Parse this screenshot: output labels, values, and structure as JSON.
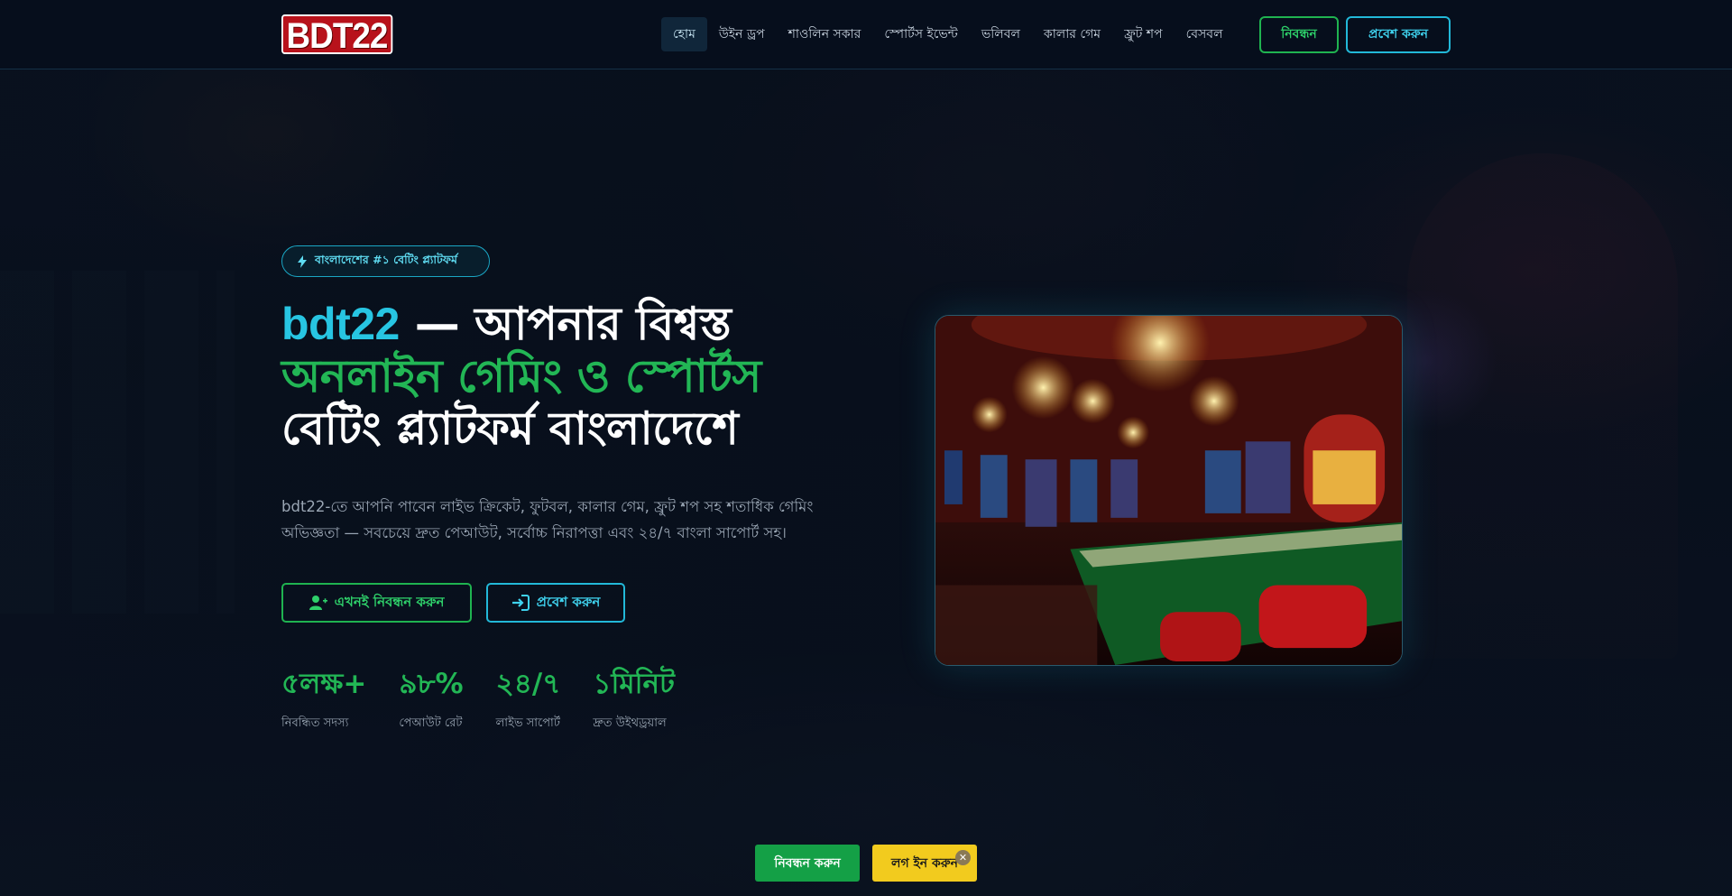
{
  "brand": {
    "logo_text": "BDT22"
  },
  "nav": {
    "items": [
      {
        "label": "হোম",
        "active": true
      },
      {
        "label": "উইন ড্রপ",
        "active": false
      },
      {
        "label": "শাওলিন সকার",
        "active": false
      },
      {
        "label": "স্পোর্টস ইভেন্ট",
        "active": false
      },
      {
        "label": "ভলিবল",
        "active": false
      },
      {
        "label": "কালার গেম",
        "active": false
      },
      {
        "label": "ফ্রুট শপ",
        "active": false
      },
      {
        "label": "বেসবল",
        "active": false
      }
    ],
    "register_label": "নিবন্ধন",
    "login_label": "প্রবেশ করুন"
  },
  "hero": {
    "badge": "বাংলাদেশের #১ বেটিং প্ল্যাটফর্ম",
    "title_brand": "bdt22",
    "title_part1": " — আপনার বিশ্বস্ত",
    "title_part2": "অনলাইন গেমিং ও স্পোর্টস",
    "title_part3": "বেটিং প্ল্যাটফর্ম বাংলাদেশে",
    "description": "bdt22-তে আপনি পাবেন লাইভ ক্রিকেট, ফুটবল, কালার গেম, ফ্রুট শপ সহ শতাধিক গেমিং অভিজ্ঞতা — সবচেয়ে দ্রুত পেআউট, সর্বোচ্চ নিরাপত্তা এবং ২৪/৭ বাংলা সাপোর্ট সহ।",
    "cta_register": "এখনই নিবন্ধন করুন",
    "cta_login": "প্রবেশ করুন"
  },
  "stats": [
    {
      "value": "৫লক্ষ+",
      "label": "নিবন্ধিত সদস্য"
    },
    {
      "value": "৯৮%",
      "label": "পেআউট রেট"
    },
    {
      "value": "২৪/৭",
      "label": "লাইভ সাপোর্ট"
    },
    {
      "value": "১মিনিট",
      "label": "দ্রুত উইথড্রয়াল"
    }
  ],
  "sticky": {
    "register_label": "নিবন্ধন করুন",
    "login_label": "লগ ইন করুন",
    "close_icon": "close-icon"
  },
  "colors": {
    "accent_green": "#22b655",
    "accent_cyan": "#27c5e2",
    "sticky_yellow": "#f2cb1e",
    "background": "#07101d"
  }
}
